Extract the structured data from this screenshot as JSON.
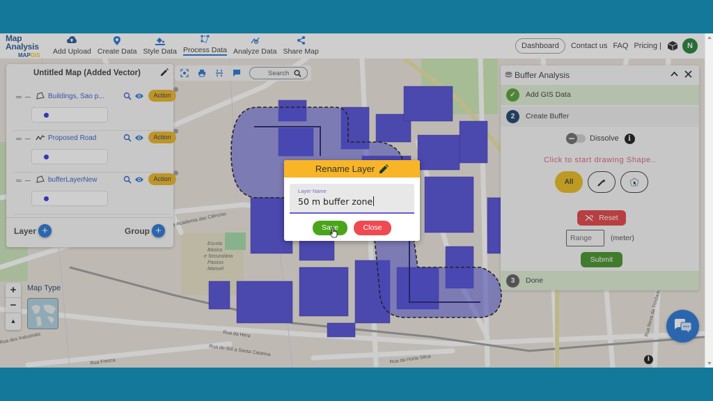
{
  "header": {
    "logo_title": "Map Analysis",
    "logo_sub_a": "MAP",
    "logo_sub_b": "GIS",
    "nav": [
      {
        "label": "Add Upload",
        "icon": "cloud-upload-icon"
      },
      {
        "label": "Create Data",
        "icon": "map-pin-icon"
      },
      {
        "label": "Style Data",
        "icon": "paint-bucket-icon"
      },
      {
        "label": "Process Data",
        "icon": "polygon-edit-icon",
        "active": true
      },
      {
        "label": "Analyze Data",
        "icon": "analyze-icon"
      },
      {
        "label": "Share Map",
        "icon": "share-icon"
      }
    ],
    "dashboard": "Dashboard",
    "contact": "Contact us",
    "faq": "FAQ",
    "pricing": "Pricing |",
    "avatar_initial": "N"
  },
  "layer_panel": {
    "title": "Untitled Map (Added Vector)",
    "layers": [
      {
        "name": "Buildings, Sao p...",
        "type": "polygon",
        "action": "Action",
        "color": "#2b2bd9"
      },
      {
        "name": "Proposed Road",
        "type": "line",
        "action": "Action",
        "color": "#2b2bd9"
      },
      {
        "name": "bufferLayerNew",
        "type": "polygon",
        "action": "Action",
        "color": "#2b2bd9"
      }
    ],
    "layer_label": "Layer",
    "group_label": "Group"
  },
  "map_toolbar": {
    "search_placeholder": "Search"
  },
  "buffer_panel": {
    "title": "Buffer Analysis",
    "steps": [
      {
        "number": "✓",
        "label": "Add GIS Data",
        "status": "complete"
      },
      {
        "number": "2",
        "label": "Create Buffer",
        "status": "active"
      },
      {
        "number": "3",
        "label": "Done",
        "status": "pending"
      }
    ],
    "dissolve_label": "Dissolve",
    "dissolve_on": false,
    "draw_hint": "Click to start drawing Shape..",
    "shape_all": "All",
    "reset": "Reset",
    "range_placeholder": "Range",
    "range_unit": "(meter)",
    "submit": "Submit"
  },
  "map_controls": {
    "zoom_in": "+",
    "zoom_out": "−",
    "north": "▲",
    "map_type_label": "Map Type"
  },
  "map_labels": {
    "street1": "Rua da Academia das Ciências",
    "street2": "Rua da Hera",
    "street3": "Rua do Sol a Santa Catarina",
    "street4": "Rua da Horta Sêca",
    "street5": "Rua dos Industriais",
    "street6": "Rua Fresca",
    "street7": "Rua Nova da Trindade",
    "school": "Escola Básica e Secundária Passos Manuel"
  },
  "modal": {
    "title": "Rename Layer",
    "field_label": "Layer Name",
    "field_value": "50 m buffer zone",
    "save": "Save",
    "close": "Close"
  },
  "colors": {
    "brand_blue": "#1c6fd1",
    "action_yellow": "#e8b01e",
    "modal_header": "#f7b527",
    "save_green": "#4aa51a",
    "close_red": "#ee4a52",
    "buffer_fill": "#3b3bd6",
    "frame_teal": "#13789a"
  }
}
